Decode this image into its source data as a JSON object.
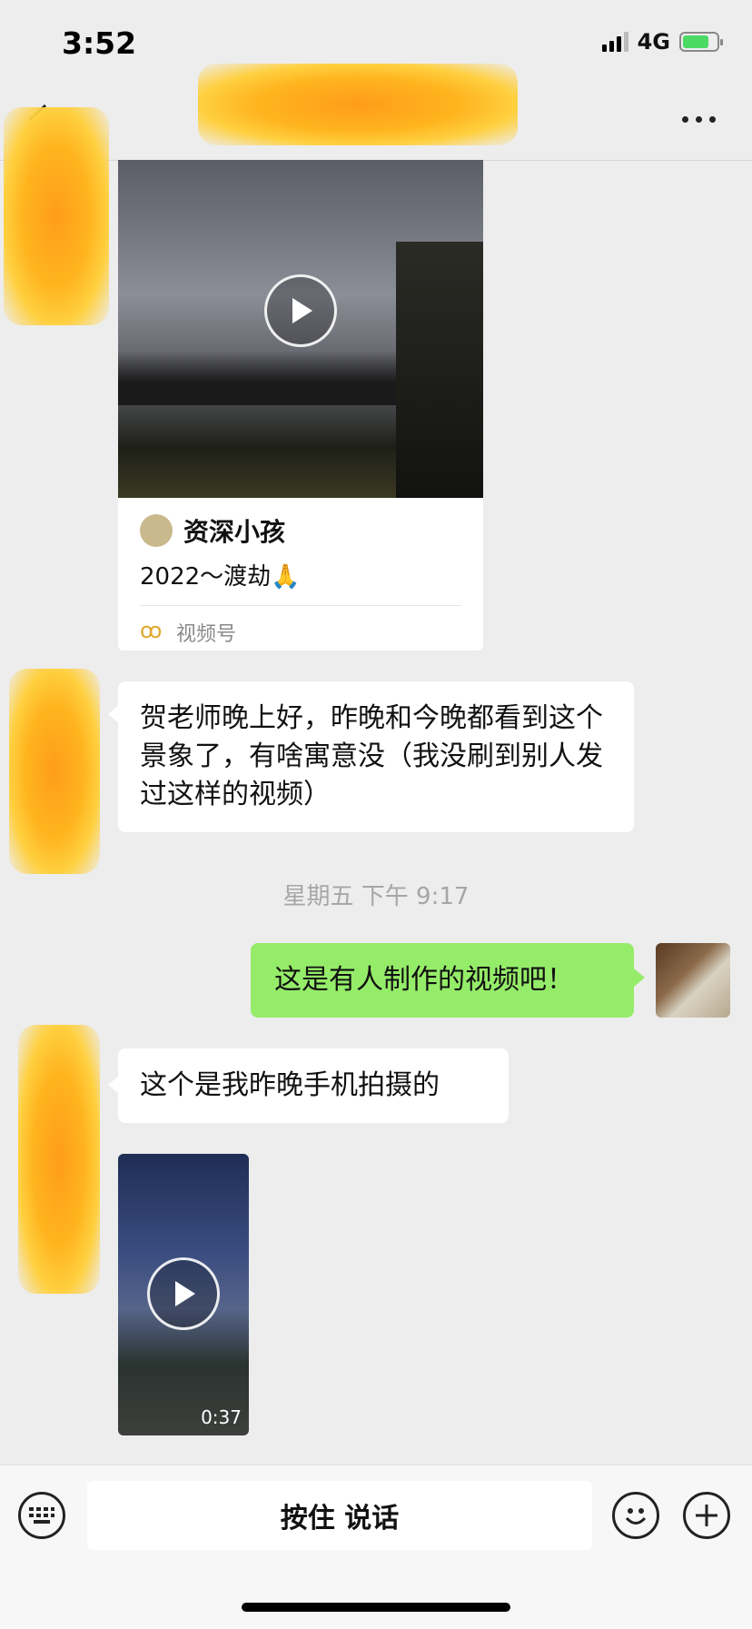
{
  "status_bar": {
    "time": "3:52",
    "network": "4G"
  },
  "chat": {
    "video_card": {
      "author": "资深小孩",
      "description": "2022～渡劫🙏",
      "source": "视频号"
    },
    "message_1": "贺老师晚上好，昨晚和今晚都看到这个景象了，有啥寓意没（我没刷到别人发过这样的视频）",
    "timestamp": "星期五 下午 9:17",
    "message_2_outgoing": "这是有人制作的视频吧！",
    "message_3": "这个是我昨晚手机拍摄的",
    "video_2": {
      "duration": "0:37"
    }
  },
  "input_bar": {
    "hold_to_talk": "按住 说话"
  },
  "colors": {
    "outgoing_bubble": "#95ec69",
    "background": "#ededed",
    "redaction": "#ffa31a"
  }
}
